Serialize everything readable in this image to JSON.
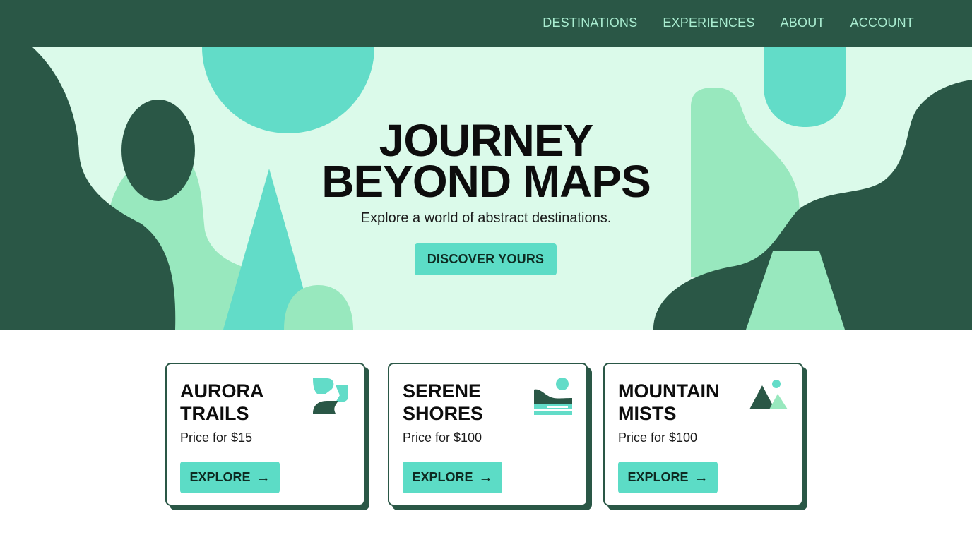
{
  "nav": {
    "items": [
      {
        "label": "DESTINATIONS"
      },
      {
        "label": "EXPERIENCES"
      },
      {
        "label": "ABOUT"
      },
      {
        "label": "ACCOUNT"
      }
    ]
  },
  "hero": {
    "title_line1": "JOURNEY",
    "title_line2": "BEYOND MAPS",
    "subtitle": "Explore a world of abstract destinations.",
    "cta_label": "DISCOVER YOURS"
  },
  "cards": [
    {
      "title_line1": "AURORA",
      "title_line2": "TRAILS",
      "price": "Price for $15",
      "button": "EXPLORE",
      "icon": "aurora-icon"
    },
    {
      "title_line1": "SERENE",
      "title_line2": "SHORES",
      "price": "Price for $100",
      "button": "EXPLORE",
      "icon": "shore-icon"
    },
    {
      "title_line1": "MOUNTAIN",
      "title_line2": "MISTS",
      "price": "Price for $100",
      "button": "EXPLORE",
      "icon": "mountain-icon"
    }
  ],
  "colors": {
    "dark_green": "#2a5746",
    "mint_bg": "#dbfaea",
    "teal": "#5cdcc6",
    "light_green": "#98e8be",
    "nav_text": "#a9ecd0"
  }
}
